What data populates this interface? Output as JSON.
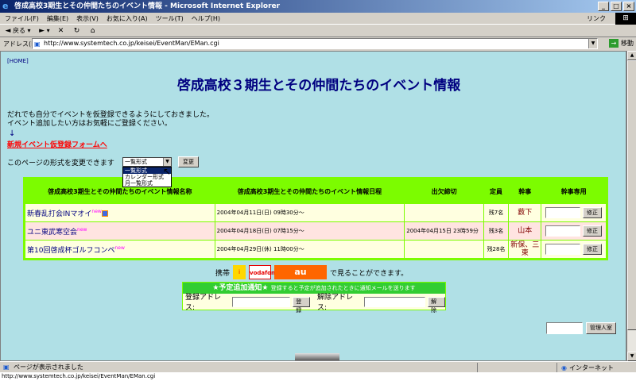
{
  "window": {
    "title": "啓成高校3期生とその仲間たちのイベント情報 - Microsoft Internet Explorer"
  },
  "menu": {
    "items": [
      "ファイル(F)",
      "編集(E)",
      "表示(V)",
      "お気に入り(A)",
      "ツール(T)",
      "ヘルプ(H)"
    ],
    "links_label": "リンク"
  },
  "toolbar": {
    "back": "戻る",
    "forward": ""
  },
  "address": {
    "label": "アドレス(D)",
    "url": "http://www.systemtech.co.jp/keisei/EventMan/EMan.cgi",
    "go_label": "移動"
  },
  "page": {
    "home_link": "[HOME]",
    "title": "啓成高校３期生とその仲間たちのイベント情報",
    "intro_line1": "だれでも自分でイベントを仮登録できるようにしておきました。",
    "intro_line2": "イベント追加したい方はお気軽にご登録ください。",
    "arrow": "↓",
    "new_form_link": "新規イベント仮登録フォームへ",
    "format_label": "このページの形式を変更できます",
    "format_selected": "一覧形式",
    "format_options": [
      "一覧形式",
      "カレンダー形式",
      "月一覧形式"
    ],
    "change_button": "変更"
  },
  "table": {
    "headers": [
      "啓成高校3期生とその仲間たちのイベント情報名称",
      "啓成高校3期生とその仲間たちのイベント情報日程",
      "出欠締切",
      "定員",
      "幹事",
      "幹事専用"
    ],
    "rows": [
      {
        "name": "新春乱打会INマオイ",
        "badge": "new",
        "date": "2004年04月11日(日) 09時30分～",
        "deadline": "",
        "capacity": "残7名",
        "manager": "薮下",
        "edit": "修正"
      },
      {
        "name": "ユニ東武寒空会",
        "badge": "new",
        "date": "2004年04月18日(日) 07時15分～",
        "deadline": "2004年04月15日 23時59分",
        "capacity": "残3名",
        "manager": "山本",
        "edit": "修正"
      },
      {
        "name": "第10回啓成杯ゴルフコンペ",
        "badge": "new",
        "date": "2004年04月29日(休) 11時00分～",
        "deadline": "",
        "capacity": "残28名",
        "manager": "新保、三東",
        "edit": "修正"
      }
    ]
  },
  "mobile": {
    "prefix": "携帯",
    "suffix": "で見ることができます。",
    "carriers": [
      "i",
      "vodafone",
      "au"
    ]
  },
  "notify": {
    "title": "★予定追加通知★",
    "note": "登録すると予定が追加されたときに通知メールを送ります",
    "register_label": "登録アドレス:",
    "register_button": "登録",
    "cancel_label": "解除アドレス:",
    "cancel_button": "解除"
  },
  "admin": {
    "button": "管理人室"
  },
  "status": {
    "text": "ページが表示されました",
    "zone": "インターネット"
  },
  "taskbar": {
    "url": "http://www.systemtech.co.jp/keisei/EventMan/EMan.cgi"
  }
}
